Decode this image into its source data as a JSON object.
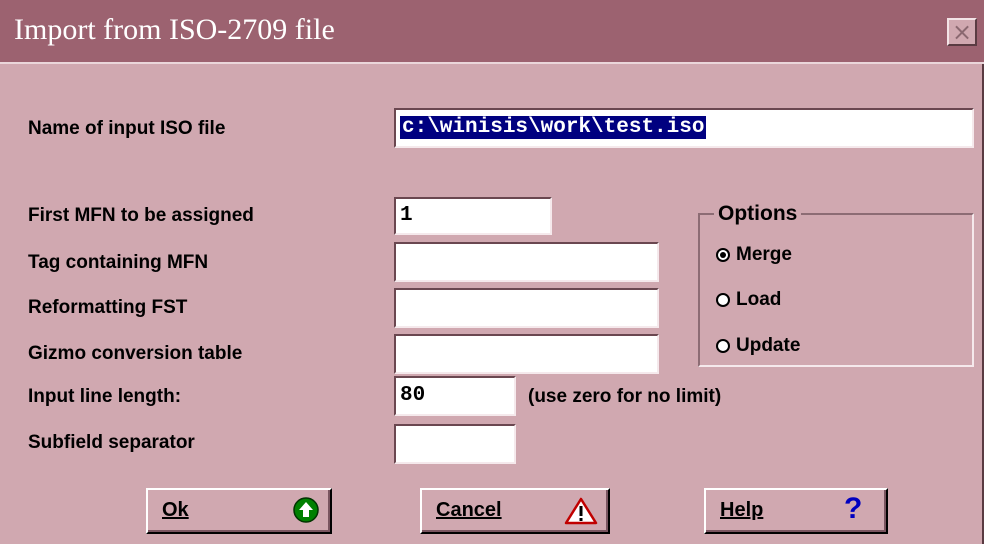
{
  "window": {
    "title": "Import from ISO-2709 file",
    "close_glyph": "×",
    "close_icon": "close-icon"
  },
  "fields": {
    "input_file": {
      "label": "Name of input ISO file",
      "value": "c:\\winisis\\work\\test.iso"
    },
    "first_mfn": {
      "label": "First MFN to be assigned",
      "value": "1"
    },
    "tag_mfn": {
      "label": "Tag containing MFN",
      "value": ""
    },
    "reformat_fst": {
      "label": "Reformatting FST",
      "value": ""
    },
    "gizmo": {
      "label": "Gizmo conversion table",
      "value": ""
    },
    "line_length": {
      "label": "Input line length:",
      "value": "80",
      "hint": "(use zero for no limit)"
    },
    "subfield_sep": {
      "label": "Subfield separator",
      "value": ""
    }
  },
  "options": {
    "legend": "Options",
    "items": [
      {
        "label": "Merge",
        "selected": true
      },
      {
        "label": "Load",
        "selected": false
      },
      {
        "label": "Update",
        "selected": false
      }
    ]
  },
  "buttons": {
    "ok": {
      "label": "Ok",
      "icon": "green-up-arrow-icon",
      "color": "#008000"
    },
    "cancel": {
      "label": "Cancel",
      "icon": "warning-triangle-icon",
      "color": "#c00000"
    },
    "help": {
      "label": "Help",
      "icon": "question-mark-icon",
      "glyph": "?",
      "color": "#0000c0"
    }
  }
}
